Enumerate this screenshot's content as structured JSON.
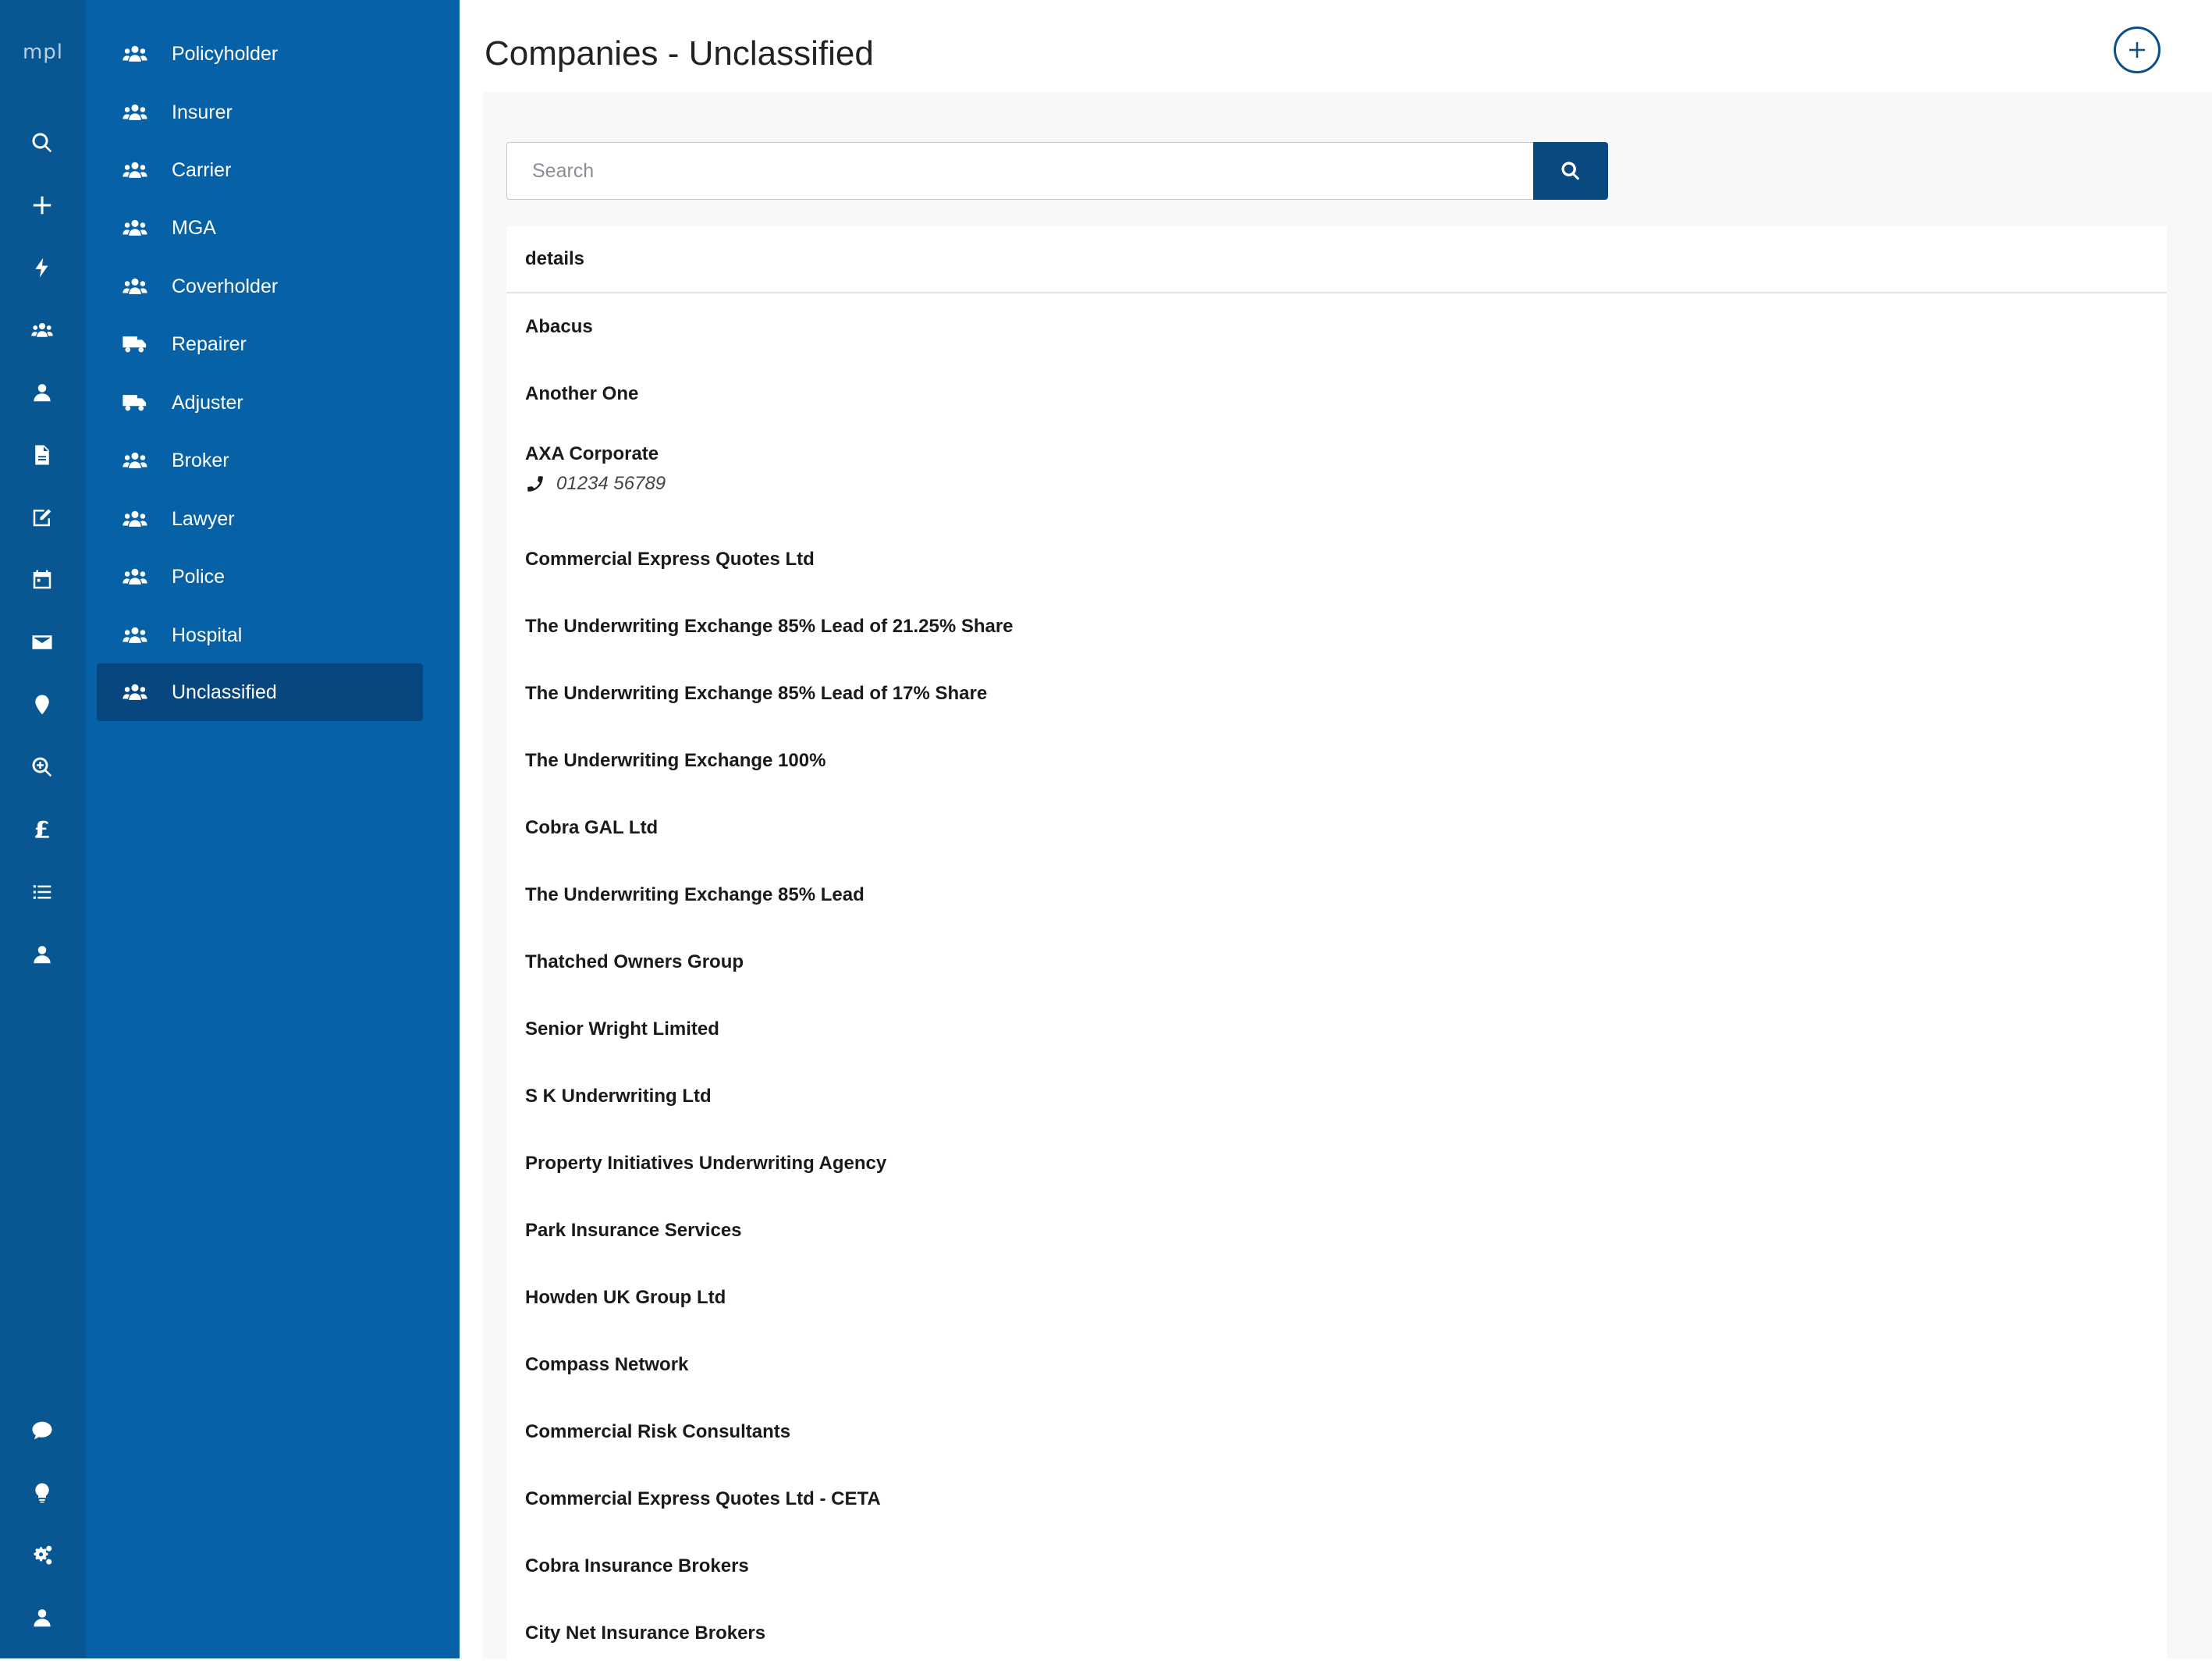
{
  "app": {
    "logo": "mpl"
  },
  "rail": {
    "top_icons": [
      "search-icon",
      "plus-icon",
      "bolt-icon",
      "users-icon",
      "user-icon",
      "file-icon",
      "edit-icon",
      "calendar-icon",
      "envelope-icon",
      "map-marker-icon",
      "zoom-icon",
      "pound-icon",
      "list-icon",
      "user-icon"
    ],
    "bottom_icons": [
      "comment-icon",
      "lightbulb-icon",
      "cogs-icon",
      "user-icon"
    ]
  },
  "sidebar": {
    "items": [
      {
        "label": "Policyholder",
        "icon": "users-icon"
      },
      {
        "label": "Insurer",
        "icon": "users-icon"
      },
      {
        "label": "Carrier",
        "icon": "users-icon"
      },
      {
        "label": "MGA",
        "icon": "users-icon"
      },
      {
        "label": "Coverholder",
        "icon": "users-icon"
      },
      {
        "label": "Repairer",
        "icon": "truck-icon"
      },
      {
        "label": "Adjuster",
        "icon": "truck-icon"
      },
      {
        "label": "Broker",
        "icon": "users-icon"
      },
      {
        "label": "Lawyer",
        "icon": "users-icon"
      },
      {
        "label": "Police",
        "icon": "users-icon"
      },
      {
        "label": "Hospital",
        "icon": "users-icon"
      },
      {
        "label": "Unclassified",
        "icon": "users-icon",
        "active": true
      }
    ]
  },
  "main": {
    "title": "Companies - Unclassified",
    "search": {
      "placeholder": "Search",
      "value": ""
    },
    "table": {
      "header": "details",
      "rows": [
        {
          "name": "Abacus"
        },
        {
          "name": "Another One"
        },
        {
          "name": "AXA Corporate",
          "phone": "01234 56789"
        },
        {
          "name": "Commercial Express Quotes Ltd"
        },
        {
          "name": "The Underwriting Exchange 85% Lead of 21.25% Share"
        },
        {
          "name": "The Underwriting Exchange 85% Lead of 17% Share"
        },
        {
          "name": "The Underwriting Exchange 100%"
        },
        {
          "name": "Cobra GAL Ltd"
        },
        {
          "name": "The Underwriting Exchange 85% Lead"
        },
        {
          "name": "Thatched Owners Group"
        },
        {
          "name": "Senior Wright Limited"
        },
        {
          "name": "S K Underwriting Ltd"
        },
        {
          "name": "Property Initiatives Underwriting Agency"
        },
        {
          "name": "Park Insurance Services"
        },
        {
          "name": "Howden UK Group Ltd"
        },
        {
          "name": "Compass Network"
        },
        {
          "name": "Commercial Risk Consultants"
        },
        {
          "name": "Commercial Express Quotes Ltd - CETA"
        },
        {
          "name": "Cobra Insurance Brokers"
        },
        {
          "name": "City Net Insurance Brokers"
        }
      ]
    }
  },
  "colors": {
    "rail_bg": "#085692",
    "sidebar_bg": "#0661a6",
    "sidebar_active": "#07467f",
    "accent": "#08497f"
  }
}
